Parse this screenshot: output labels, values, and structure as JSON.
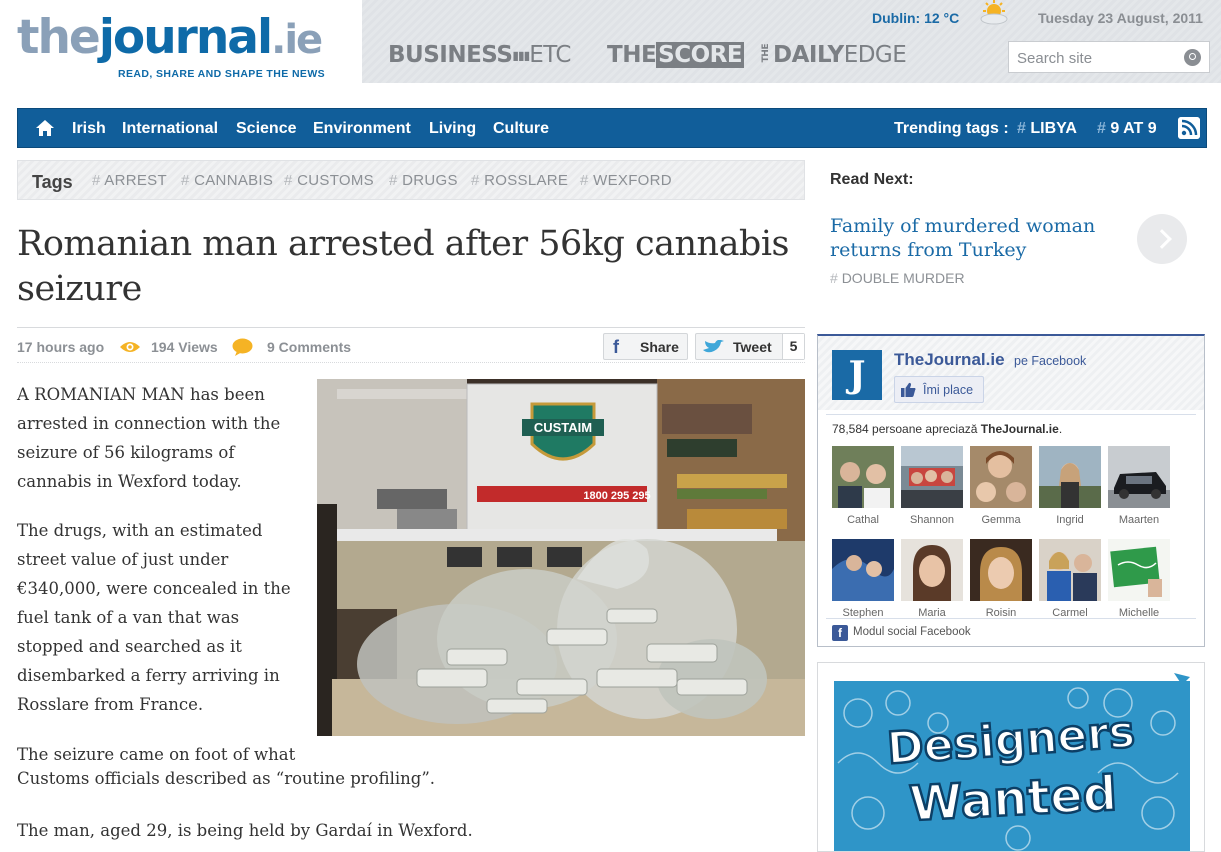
{
  "header": {
    "logo": {
      "the": "the",
      "journal": "journal",
      "ie": ".ie",
      "tagline": "READ, SHARE AND SHAPE THE NEWS"
    },
    "weather": "Dublin: 12 °C",
    "weather_icon": "sun-cloud-icon",
    "date": "Tuesday 23 August, 2011",
    "brands": {
      "business_bold": "BUSINESS",
      "business_thin": "ETC",
      "score_the": "THE",
      "score_box": "SCORE",
      "edge_the": "THE",
      "edge_bold": "DAILY",
      "edge_thin": "EDGE"
    },
    "search": {
      "placeholder": "Search site"
    }
  },
  "nav": {
    "items": [
      "Irish",
      "International",
      "Science",
      "Environment",
      "Living",
      "Culture"
    ],
    "trending_label": "Trending tags :",
    "trending": [
      {
        "hash": "#",
        "label": "LIBYA"
      },
      {
        "hash": "#",
        "label": "9 AT 9"
      }
    ]
  },
  "tags": {
    "label": "Tags",
    "items": [
      {
        "hash": "#",
        "label": "ARREST"
      },
      {
        "hash": "#",
        "label": "CANNABIS"
      },
      {
        "hash": "#",
        "label": "CUSTOMS"
      },
      {
        "hash": "#",
        "label": "DRUGS"
      },
      {
        "hash": "#",
        "label": "ROSSLARE"
      },
      {
        "hash": "#",
        "label": "WEXFORD"
      }
    ]
  },
  "article": {
    "headline": "Romanian man arrested after 56kg cannabis seizure",
    "time_ago": "17 hours ago",
    "views": "194 Views",
    "comments": "9 Comments",
    "share_label": "Share",
    "tweet_label": "Tweet",
    "tweet_count": "5",
    "p1": "A ROMANIAN MAN has been arrested in connection with the seizure of 56 kilograms of cannabis in Wexford today.",
    "p2": "The drugs, with an estimated street value of just under €340,000, were concealed in the fuel tank of a van that was stopped and searched as it disembarked a ferry arriving in Rosslare from France.",
    "p3_line1": "The seizure came on foot of what",
    "p3_line2": "Customs officials described as “routine profiling”.",
    "p4": "The man, aged 29, is being held by Gardaí in Wexford.",
    "photo": {
      "sign": "CUSTAIM",
      "phone": "1800 295 295"
    }
  },
  "sidebar": {
    "read_next_label": "Read Next:",
    "read_next_title": "Family of murdered woman returns from Turkey",
    "read_next_tag": {
      "hash": "#",
      "label": "DOUBLE MURDER"
    },
    "facebook": {
      "logo_letter": "J",
      "page_name": "TheJournal.ie",
      "pe": "pe Facebook",
      "like_label": "Îmi place",
      "count_prefix": "78,584 persoane apreciază ",
      "count_page": "TheJournal.ie",
      "count_suffix": ".",
      "friends": [
        "Cathal",
        "Shannon",
        "Gemma",
        "Ingrid",
        "Maarten",
        "Stephen",
        "Maria",
        "Roisin",
        "Carmel",
        "Michelle"
      ],
      "footer_icon": "f",
      "footer": "Modul social Facebook"
    },
    "ad": {
      "line1": "Designers",
      "line2": "Wanted"
    }
  },
  "colors": {
    "brand_blue": "#115e9a",
    "link_blue": "#1a6aa6",
    "facebook_blue": "#3b5998",
    "muted_gray": "#8c9095"
  }
}
